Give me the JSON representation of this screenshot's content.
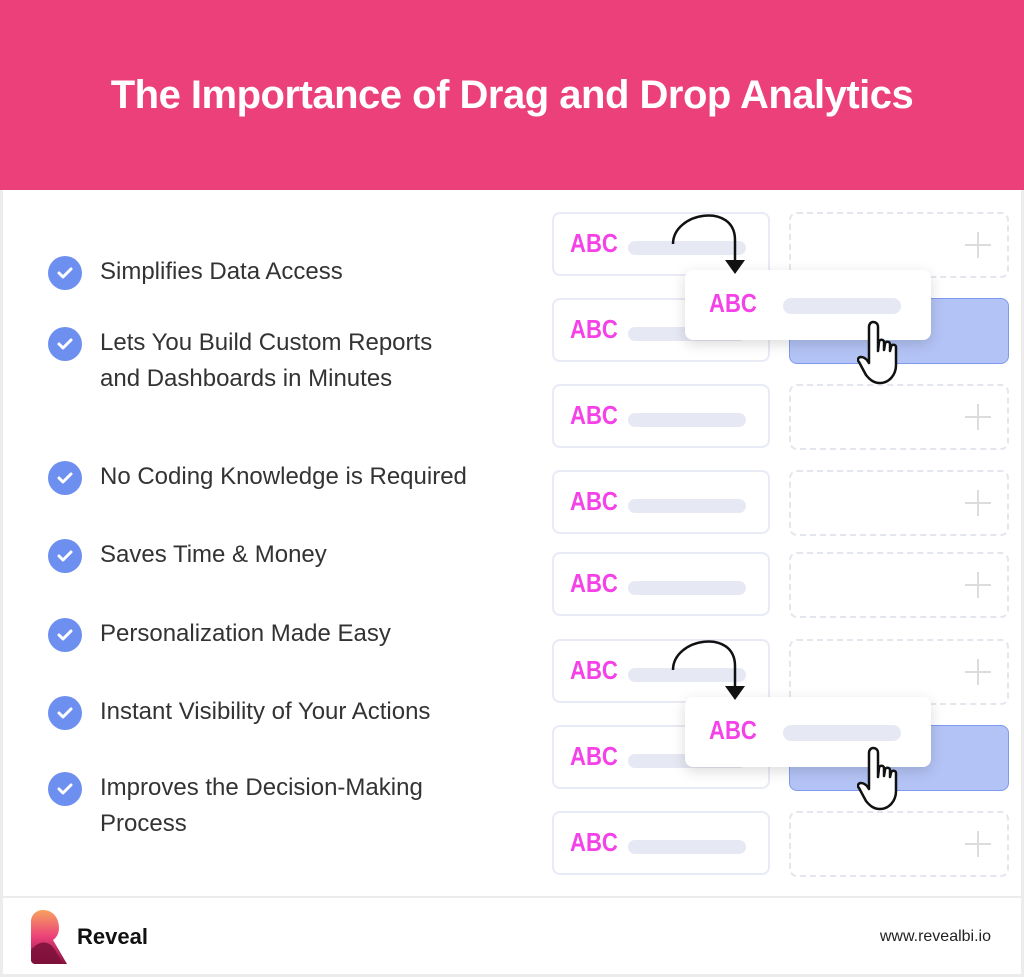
{
  "header": {
    "title": "The Importance of Drag and Drop Analytics"
  },
  "benefits": [
    {
      "text": "Simplifies Data Access"
    },
    {
      "text": "Lets You Build Custom Reports and Dashboards in Minutes"
    },
    {
      "text": "No Coding Knowledge is Required"
    },
    {
      "text": "Saves Time & Money"
    },
    {
      "text": "Personalization Made Easy"
    },
    {
      "text": "Instant Visibility of Your Actions"
    },
    {
      "text": "Improves the Decision-Making Process"
    }
  ],
  "illustration": {
    "field_label": "ABC",
    "drag_card_label": "ABC",
    "field_count": 8
  },
  "footer": {
    "brand": "Reveal",
    "url": "www.revealbi.io"
  },
  "colors": {
    "accent": "#ec407a",
    "check": "#6d8ff0",
    "field_text": "#f542e8",
    "drop_target": "#b3c3f5"
  }
}
